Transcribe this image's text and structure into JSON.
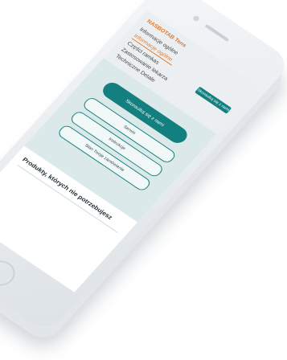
{
  "menu": {
    "title": "NASBOTAB Tens",
    "items": [
      {
        "label": "Informacje ogólne",
        "active": false
      },
      {
        "label": "Informacje ogólne",
        "active": true
      },
      {
        "label": "Części ramkas",
        "active": false
      },
      {
        "label": "Zastosowanie lekarza",
        "active": false
      },
      {
        "label": "Techniczne Detale",
        "active": false
      }
    ],
    "side_button": "Skonsultuj się z nami"
  },
  "main": {
    "primary_button": "Skonsultuj się z nami",
    "options": [
      "Serwis",
      "Instrukcje",
      "Stan Twoje zamówienie"
    ]
  },
  "footer": {
    "heading": "Produkty, których nie potrzebujesz"
  },
  "colors": {
    "accent": "#13807f",
    "highlight": "#e0782a",
    "panel": "#dbe9ea"
  }
}
